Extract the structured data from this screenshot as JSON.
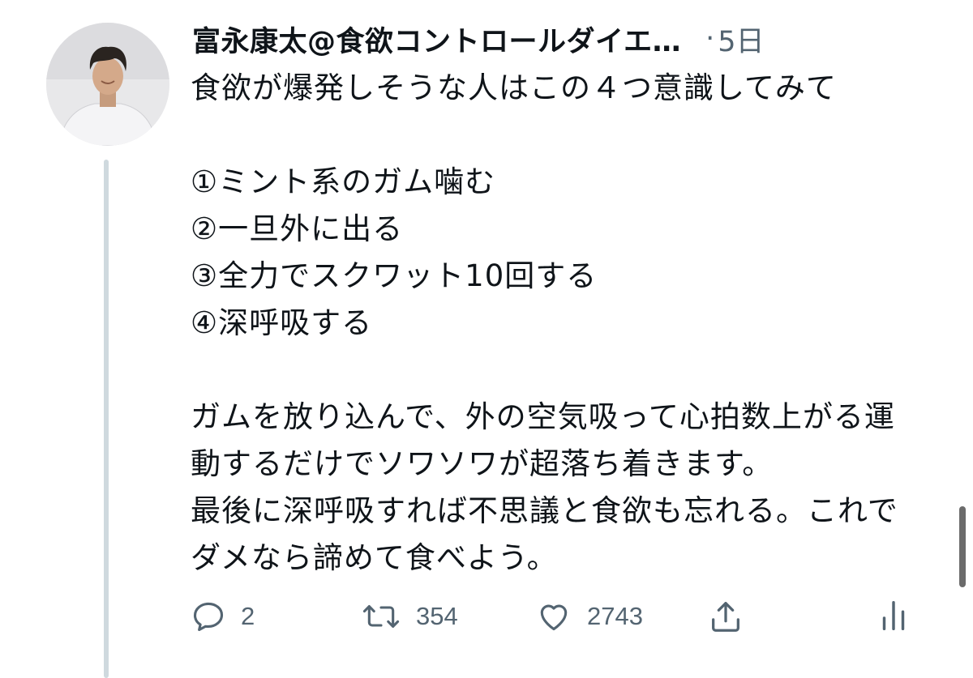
{
  "tweet": {
    "author_name": "富永康太@食欲コントロールダイエ…",
    "separator": "·",
    "time": "5日",
    "text": "食欲が爆発しそうな人はこの４つ意識してみて\n\n①ミント系のガム噛む\n②一旦外に出る\n③全力でスクワット10回する\n④深呼吸する\n\nガムを放り込んで、外の空気吸って心拍数上がる運動するだけでソワソワが超落ち着きます。\n最後に深呼吸すれば不思議と食欲も忘れる。これでダメなら諦めて食べよう。"
  },
  "actions": {
    "reply_icon": "reply-icon",
    "reply_count": "2",
    "retweet_icon": "retweet-icon",
    "retweet_count": "354",
    "like_icon": "heart-icon",
    "like_count": "2743",
    "share_icon": "share-icon",
    "analytics_icon": "analytics-icon"
  },
  "colors": {
    "text": "#0f1419",
    "secondary": "#536471",
    "thread_line": "#cfd9de"
  }
}
